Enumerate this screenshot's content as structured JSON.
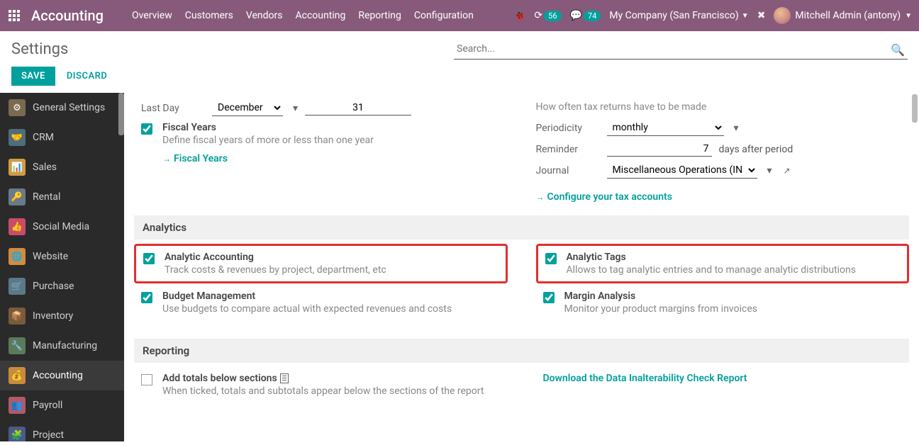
{
  "topbar": {
    "brand": "Accounting",
    "nav": [
      "Overview",
      "Customers",
      "Vendors",
      "Accounting",
      "Reporting",
      "Configuration"
    ],
    "badge1": "56",
    "badge2": "74",
    "company": "My Company (San Francisco)",
    "user": "Mitchell Admin (antony)"
  },
  "page": {
    "title": "Settings",
    "search_placeholder": "Search...",
    "save": "SAVE",
    "discard": "DISCARD"
  },
  "sidebar": {
    "items": [
      {
        "label": "General Settings",
        "color": "#7a6a4f"
      },
      {
        "label": "CRM",
        "color": "#4f6d7a"
      },
      {
        "label": "Sales",
        "color": "#d39c3e"
      },
      {
        "label": "Rental",
        "color": "#6a7a8a"
      },
      {
        "label": "Social Media",
        "color": "#c94b6a"
      },
      {
        "label": "Website",
        "color": "#d38b3e"
      },
      {
        "label": "Purchase",
        "color": "#5a7a8a"
      },
      {
        "label": "Inventory",
        "color": "#7a5a3a"
      },
      {
        "label": "Manufacturing",
        "color": "#5a7a5a"
      },
      {
        "label": "Accounting",
        "color": "#c98b3e"
      },
      {
        "label": "Payroll",
        "color": "#b05a6a"
      },
      {
        "label": "Project",
        "color": "#4a5a8a"
      }
    ]
  },
  "fiscal": {
    "last_day_label": "Last Day",
    "month": "December",
    "day": "31",
    "fy_title": "Fiscal Years",
    "fy_desc": "Define fiscal years of more or less than one year",
    "fy_link": "Fiscal Years"
  },
  "tax": {
    "freq_desc": "How often tax returns have to be made",
    "periodicity_label": "Periodicity",
    "periodicity_value": "monthly",
    "reminder_label": "Reminder",
    "reminder_value": "7",
    "reminder_suffix": "days after period",
    "journal_label": "Journal",
    "journal_value": "Miscellaneous Operations (IN",
    "config_link": "Configure your tax accounts"
  },
  "sections": {
    "analytics": "Analytics",
    "reporting": "Reporting"
  },
  "analytics": {
    "aa_title": "Analytic Accounting",
    "aa_desc": "Track costs & revenues by project, department, etc",
    "at_title": "Analytic Tags",
    "at_desc": "Allows to tag analytic entries and to manage analytic distributions",
    "bm_title": "Budget Management",
    "bm_desc": "Use budgets to compare actual with expected revenues and costs",
    "ma_title": "Margin Analysis",
    "ma_desc": "Monitor your product margins from invoices"
  },
  "reporting": {
    "totals_title": "Add totals below sections",
    "totals_desc": "When ticked, totals and subtotals appear below the sections of the report",
    "dl_link": "Download the Data Inalterability Check Report"
  }
}
